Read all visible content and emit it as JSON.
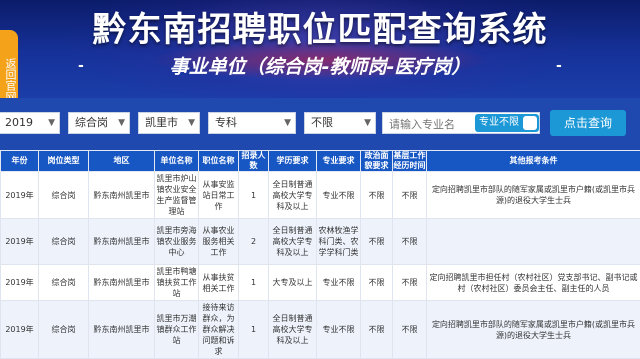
{
  "header": {
    "title": "黔东南招聘职位匹配查询系统",
    "subtitle": "事业单位（综合岗-教师岗-医疗岗）",
    "subtitle_dash": "-"
  },
  "side_tab": {
    "label": "返回官网"
  },
  "filters": {
    "year": "2019",
    "post_type": "综合岗",
    "region": "凯里市",
    "education": "专科",
    "major_limit": "不限",
    "keyword_placeholder": "请输入专业名",
    "major_toggle_label": "专业不限",
    "search_button": "点击查询"
  },
  "table": {
    "headers": [
      "年份",
      "岗位类型",
      "地区",
      "单位名称",
      "职位名称",
      "招录人数",
      "学历要求",
      "专业要求",
      "政治面貌要求",
      "基层工作经历时间",
      "其他报考条件"
    ],
    "rows": [
      [
        "2019年",
        "综合岗",
        "黔东南州凯里市",
        "凯里市炉山镇农业安全生产监督管理站",
        "从事安监站日常工作",
        "1",
        "全日制普通高校大学专科及以上",
        "专业不限",
        "不限",
        "不限",
        "定向招聘凯里市部队的随军家属或凯里市户籍(或凯里市兵源)的退役大学生士兵"
      ],
      [
        "2019年",
        "综合岗",
        "黔东南州凯里市",
        "凯里市旁海镇农业服务中心",
        "从事农业服务相关工作",
        "2",
        "全日制普通高校大学专科及以上",
        "农林牧渔学科门类、农学学科门类",
        "不限",
        "不限",
        ""
      ],
      [
        "2019年",
        "综合岗",
        "黔东南州凯里市",
        "凯里市鸭塘镇扶贫工作站",
        "从事扶贫相关工作",
        "1",
        "大专及以上",
        "专业不限",
        "不限",
        "不限",
        "定向招聘凯里市担任村（农村社区）党支部书记、副书记或村（农村社区）委员会主任、副主任的人员"
      ],
      [
        "2019年",
        "综合岗",
        "黔东南州凯里市",
        "凯里市万潮镇群众工作站",
        "接待来访群众，为群众解决问题和诉求",
        "1",
        "全日制普通高校大学专科及以上",
        "专业不限",
        "不限",
        "不限",
        "定向招聘凯里市部队的随军家属或凯里市户籍(或凯里市兵源)的退役大学生士兵"
      ]
    ]
  }
}
